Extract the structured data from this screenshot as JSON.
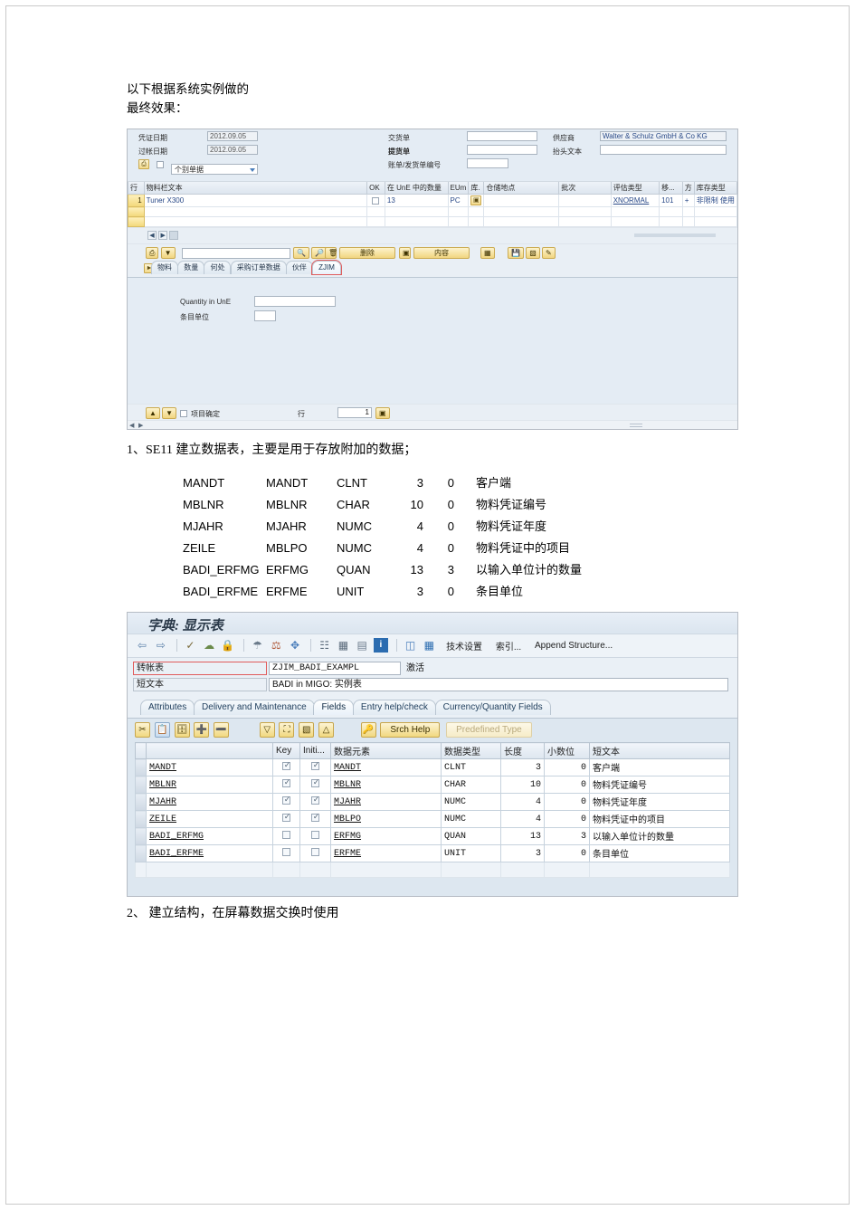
{
  "document": {
    "intro_line1": "以下根据系统实例做的",
    "intro_line2": "最终效果：",
    "step1": "1、SE11 建立数据表，主要是用于存放附加的数据；",
    "step2": "2、 建立结构，在屏幕数据交换时使用"
  },
  "migo": {
    "header_fields": {
      "doc_date_label": "凭证日期",
      "doc_date_value": "2012.09.05",
      "posting_date_label": "过帐日期",
      "posting_date_value": "2012.09.05",
      "print_combo_value": "个别单据",
      "delivery_note_label": "交货单",
      "delivery_note_value": "",
      "bill_of_lading_label": "提货单",
      "bill_of_lading_value": "",
      "vendor_doc_label": "账单/发货单编号",
      "vendor_doc_value": "",
      "vendor_label": "供应商",
      "vendor_value": "Walter & Schulz GmbH & Co KG",
      "header_text_label": "抬头文本",
      "header_text_value": ""
    },
    "item_table": {
      "headers": [
        "行",
        "物料栏文本",
        "OK",
        "在 UnE 中的数量",
        "EUm",
        "库.",
        "仓储地点",
        "批次",
        "评估类型",
        "移...",
        "方",
        "库存类型"
      ],
      "rows": [
        {
          "line": "1",
          "material_text": "Tuner X300",
          "ok": false,
          "qty_une": "13",
          "eum": "PC",
          "stock_icon": "warehouse-icon",
          "storage_loc": "",
          "batch": "",
          "valuation_type": "XNORMAL",
          "movement": "101",
          "sign": "+",
          "stock_type": "非限制 使用"
        }
      ]
    },
    "grid_toolbar": {
      "print_icon": "print-icon",
      "filter_icon": "filter-icon",
      "search_value": "",
      "find_icon": "find-icon",
      "find_next_icon": "find-next-icon",
      "delete_icon": "trash-icon",
      "delete_label": "删除",
      "content_icon": "content-icon",
      "content_label": "内容",
      "layout_icon": "layout-icon",
      "save_icon": "save-icon",
      "detail_icon": "detail-icon",
      "help_icon": "help-icon"
    },
    "detail_tabs": [
      {
        "label": "物料",
        "selected": false
      },
      {
        "label": "数量",
        "selected": false
      },
      {
        "label": "何处",
        "selected": false
      },
      {
        "label": "采购订单数据",
        "selected": false
      },
      {
        "label": "伙伴",
        "selected": false
      },
      {
        "label": "ZJIM",
        "selected": true
      }
    ],
    "zjim_tab": {
      "quantity_label": "Quantity in UnE",
      "quantity_value": "",
      "unit_label": "条目单位",
      "unit_value": ""
    },
    "footer": {
      "icon_left_1": "detail-prev-icon",
      "icon_left_2": "detail-next-icon",
      "item_ok_label": "项目确定",
      "item_ok_checked": false,
      "line_label": "行",
      "line_value": "1",
      "line_icon": "line-select-icon"
    }
  },
  "table_spec": {
    "rows": [
      {
        "field": "MANDT",
        "element": "MANDT",
        "type": "CLNT",
        "len": "3",
        "dec": "0",
        "text": "客户端"
      },
      {
        "field": "MBLNR",
        "element": "MBLNR",
        "type": "CHAR",
        "len": "10",
        "dec": "0",
        "text": "物料凭证编号"
      },
      {
        "field": "MJAHR",
        "element": "MJAHR",
        "type": "NUMC",
        "len": "4",
        "dec": "0",
        "text": "物料凭证年度"
      },
      {
        "field": "ZEILE",
        "element": "MBLPO",
        "type": "NUMC",
        "len": "4",
        "dec": "0",
        "text": "物料凭证中的项目"
      },
      {
        "field": "BADI_ERFMG",
        "element": "ERFMG",
        "type": "QUAN",
        "len": "13",
        "dec": "3",
        "text": "以输入单位计的数量"
      },
      {
        "field": "BADI_ERFME",
        "element": "ERFME",
        "type": "UNIT",
        "len": "3",
        "dec": "0",
        "text": "条目单位"
      }
    ]
  },
  "se11": {
    "title": "字典: 显示表",
    "toolbar": {
      "back_icon": "back-arrow-icon",
      "forward_icon": "forward-arrow-icon",
      "check_icon": "pencil-check-icon",
      "activate_icon": "activate-icon",
      "lock_icon": "lock-icon",
      "object_icon": "object-icon",
      "runtime_icon": "runtime-object-icon",
      "where_used_icon": "where-used-icon",
      "hierarchy_icon": "hierarchy-icon",
      "stack_icon": "stack-icon",
      "list_icon": "list-icon",
      "info_icon": "info-icon",
      "compare_icon": "compare-icon",
      "table_icon": "table-icon",
      "tech_settings_label": "技术设置",
      "index_label": "索引...",
      "append_label": "Append Structure..."
    },
    "fields": {
      "table_label": "转帐表",
      "table_value": "ZJIM_BADI_EXAMPL",
      "table_status": "激活",
      "short_text_label": "短文本",
      "short_text_value": "BADI in MIGO: 实例表"
    },
    "tabs": [
      {
        "label": "Attributes",
        "selected": false
      },
      {
        "label": "Delivery and Maintenance",
        "selected": false
      },
      {
        "label": "Fields",
        "selected": true
      },
      {
        "label": "Entry help/check",
        "selected": false
      },
      {
        "label": "Currency/Quantity Fields",
        "selected": false
      }
    ],
    "field_toolbar": {
      "cut_icon": "scissors-icon",
      "copy_icon": "copy-icon",
      "paste_icon": "paste-icon",
      "insert_row_icon": "insert-row-icon",
      "delete_row_icon": "delete-row-icon",
      "sort_icon": "sort-icon",
      "expand_icon": "expand-icon",
      "collapse_icon": "collapse-icon",
      "up_icon": "move-up-icon",
      "key_icon": "key-icon",
      "srch_help_label": "Srch Help",
      "predefined_type_label": "Predefined Type"
    },
    "field_table": {
      "headers": [
        "",
        "",
        "Key",
        "Initi...",
        "数据元素",
        "数据类型",
        "长度",
        "小数位",
        "短文本"
      ],
      "rows": [
        {
          "field": "MANDT",
          "key": true,
          "init": true,
          "element": "MANDT",
          "type": "CLNT",
          "len": "3",
          "dec": "0",
          "text": "客户端"
        },
        {
          "field": "MBLNR",
          "key": true,
          "init": true,
          "element": "MBLNR",
          "type": "CHAR",
          "len": "10",
          "dec": "0",
          "text": "物料凭证编号"
        },
        {
          "field": "MJAHR",
          "key": true,
          "init": true,
          "element": "MJAHR",
          "type": "NUMC",
          "len": "4",
          "dec": "0",
          "text": "物料凭证年度"
        },
        {
          "field": "ZEILE",
          "key": true,
          "init": true,
          "element": "MBLPO",
          "type": "NUMC",
          "len": "4",
          "dec": "0",
          "text": "物料凭证中的项目"
        },
        {
          "field": "BADI_ERFMG",
          "key": false,
          "init": false,
          "element": "ERFMG",
          "type": "QUAN",
          "len": "13",
          "dec": "3",
          "text": "以输入单位计的数量"
        },
        {
          "field": "BADI_ERFME",
          "key": false,
          "init": false,
          "element": "ERFME",
          "type": "UNIT",
          "len": "3",
          "dec": "0",
          "text": "条目单位"
        }
      ]
    }
  },
  "colors": {
    "accent": "#4a7ebb",
    "sap_yellow": "#f1d57f",
    "highlight_red": "#e05c5c",
    "link_blue": "#2a4a88"
  }
}
